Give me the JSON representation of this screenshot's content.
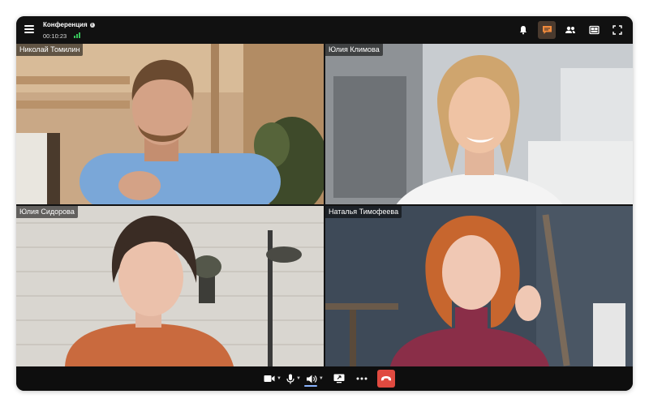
{
  "conference": {
    "title": "Конференция",
    "duration": "00:10:23",
    "signal_color": "#37c25a"
  },
  "toolbar_icons": [
    "menu-icon",
    "info-icon",
    "bell-icon",
    "chat-icon",
    "participants-icon",
    "layout-icon",
    "fullscreen-icon"
  ],
  "participants": [
    {
      "name": "Николай Томилин"
    },
    {
      "name": "Юлия Климова"
    },
    {
      "name": "Юлия Сидорова"
    },
    {
      "name": "Наталья Тимофеева"
    }
  ],
  "controls": [
    "camera-icon",
    "microphone-icon",
    "speaker-icon",
    "screen-share-icon",
    "more-icon",
    "hang-up-icon"
  ],
  "colors": {
    "window_bg": "#121212",
    "active_chat": "#4a3a2e",
    "hangup": "#e04a40",
    "chat_accent": "#f08a3c"
  }
}
